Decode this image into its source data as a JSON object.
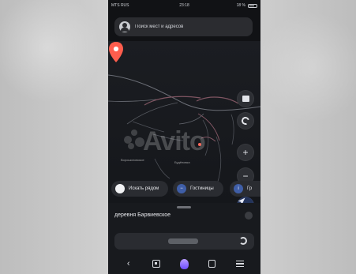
{
  "status_bar": {
    "carrier": "MTS RUS",
    "time": "23:18",
    "battery": "18 %"
  },
  "search": {
    "placeholder": "Поиск мест и адресов"
  },
  "map": {
    "watermark": "Avito",
    "place_labels": [
      "Ворошиловское",
      "Будёновка"
    ]
  },
  "controls": {
    "layers_icon": "layers-icon",
    "rotate_icon": "compass-icon",
    "zoom_in": "+",
    "zoom_out": "−",
    "location_icon": "navigation-arrow-icon"
  },
  "chips": [
    {
      "label": "Искать рядом"
    },
    {
      "label": "Гостиницы"
    },
    {
      "label": "Гр"
    }
  ],
  "sheet": {
    "title": "деревня Барвиевское"
  },
  "browser": {
    "reload_icon": "reload-icon"
  },
  "nav": {
    "back": "‹"
  }
}
